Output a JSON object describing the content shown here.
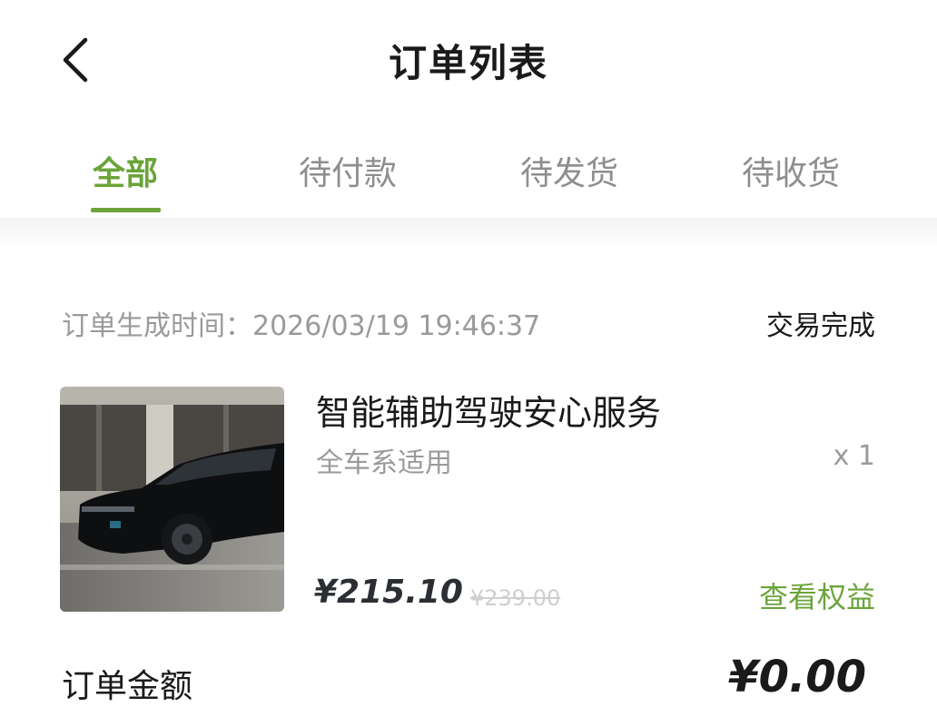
{
  "header": {
    "title": "订单列表",
    "back_icon": "chevron-left-icon"
  },
  "tabs": [
    {
      "label": "全部",
      "active": true
    },
    {
      "label": "待付款",
      "active": false
    },
    {
      "label": "待发货",
      "active": false
    },
    {
      "label": "待收货",
      "active": false
    }
  ],
  "colors": {
    "accent": "#6ba43a",
    "text_primary": "#1a1a1a",
    "text_secondary": "#9a9a9a"
  },
  "order": {
    "time_label": "订单生成时间：2026/03/19 19:46:37",
    "status": "交易完成",
    "product": {
      "name": "智能辅助驾驶安心服务",
      "desc": "全车系适用",
      "qty": "x 1",
      "price": "¥215.10",
      "original_price": "¥239.00",
      "image": "black-suv-photo"
    },
    "view_benefits": "查看权益",
    "total_label": "订单金额",
    "total_amount": "¥0.00"
  }
}
